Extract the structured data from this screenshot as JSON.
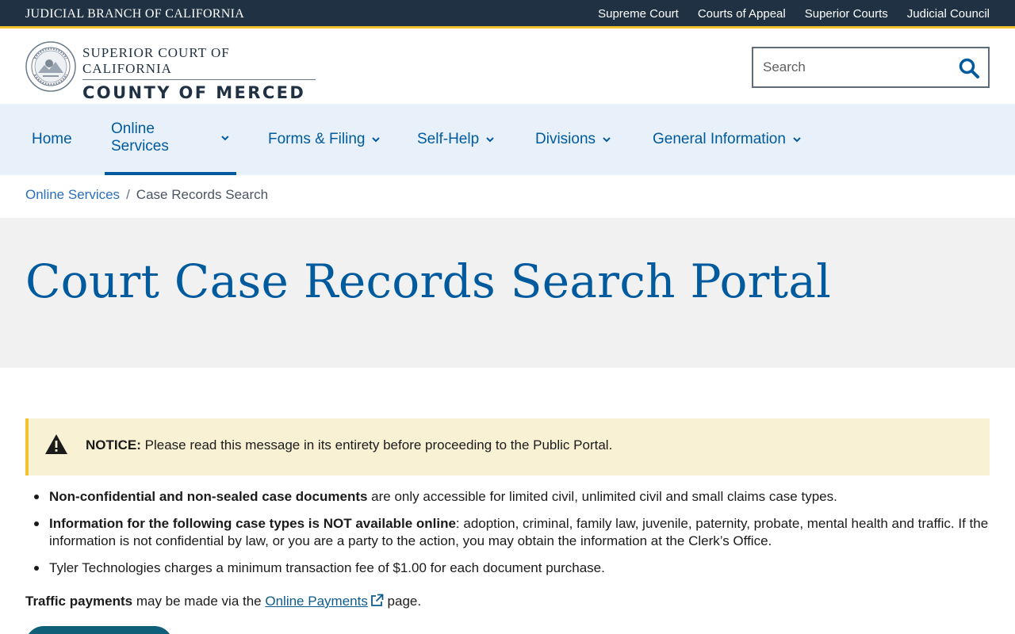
{
  "topbar": {
    "brand": "JUDICIAL BRANCH OF CALIFORNIA",
    "links": [
      "Supreme Court",
      "Courts of Appeal",
      "Superior Courts",
      "Judicial Council"
    ]
  },
  "header": {
    "court_line1": "SUPERIOR COURT OF CALIFORNIA",
    "court_line2": "COUNTY OF MERCED",
    "search_placeholder": "Search"
  },
  "nav": {
    "items": [
      {
        "label": "Home"
      },
      {
        "label": "Online Services"
      },
      {
        "label": "Forms & Filing"
      },
      {
        "label": "Self-Help"
      },
      {
        "label": "Divisions"
      },
      {
        "label": "General Information"
      }
    ]
  },
  "breadcrumb": {
    "parent": "Online Services",
    "separator": "/",
    "current": "Case Records Search"
  },
  "hero": {
    "title": "Court Case Records Search Portal"
  },
  "notice": {
    "label": "NOTICE:",
    "text": "Please read this message in its entirety before proceeding to the Public Portal."
  },
  "info": {
    "item1_bold": "Non-confidential and non-sealed case documents",
    "item1_text": " are only accessible for limited civil, unlimited civil and small claims case types.",
    "item2_bold": "Information for the following case types is NOT available online",
    "item2_text": ":  adoption, criminal, family law, juvenile, paternity, probate, mental health and traffic. If the information is not confidential by law, or you are a party to the action, you may obtain the information at the Clerk’s Office.",
    "item3_text": "Tyler Technologies charges a minimum transaction fee of $1.00 for each document purchase."
  },
  "traffic": {
    "bold": "Traffic payments",
    "pre_link": " may be made via the ",
    "link": "Online Payments",
    "post_link": " page."
  },
  "colors": {
    "topbar_bg": "#1f3143",
    "accent_gold": "#f2c230",
    "link_blue": "#005a9e",
    "nav_bg": "#e8f1f9",
    "notice_bg": "#f8f1d3"
  }
}
